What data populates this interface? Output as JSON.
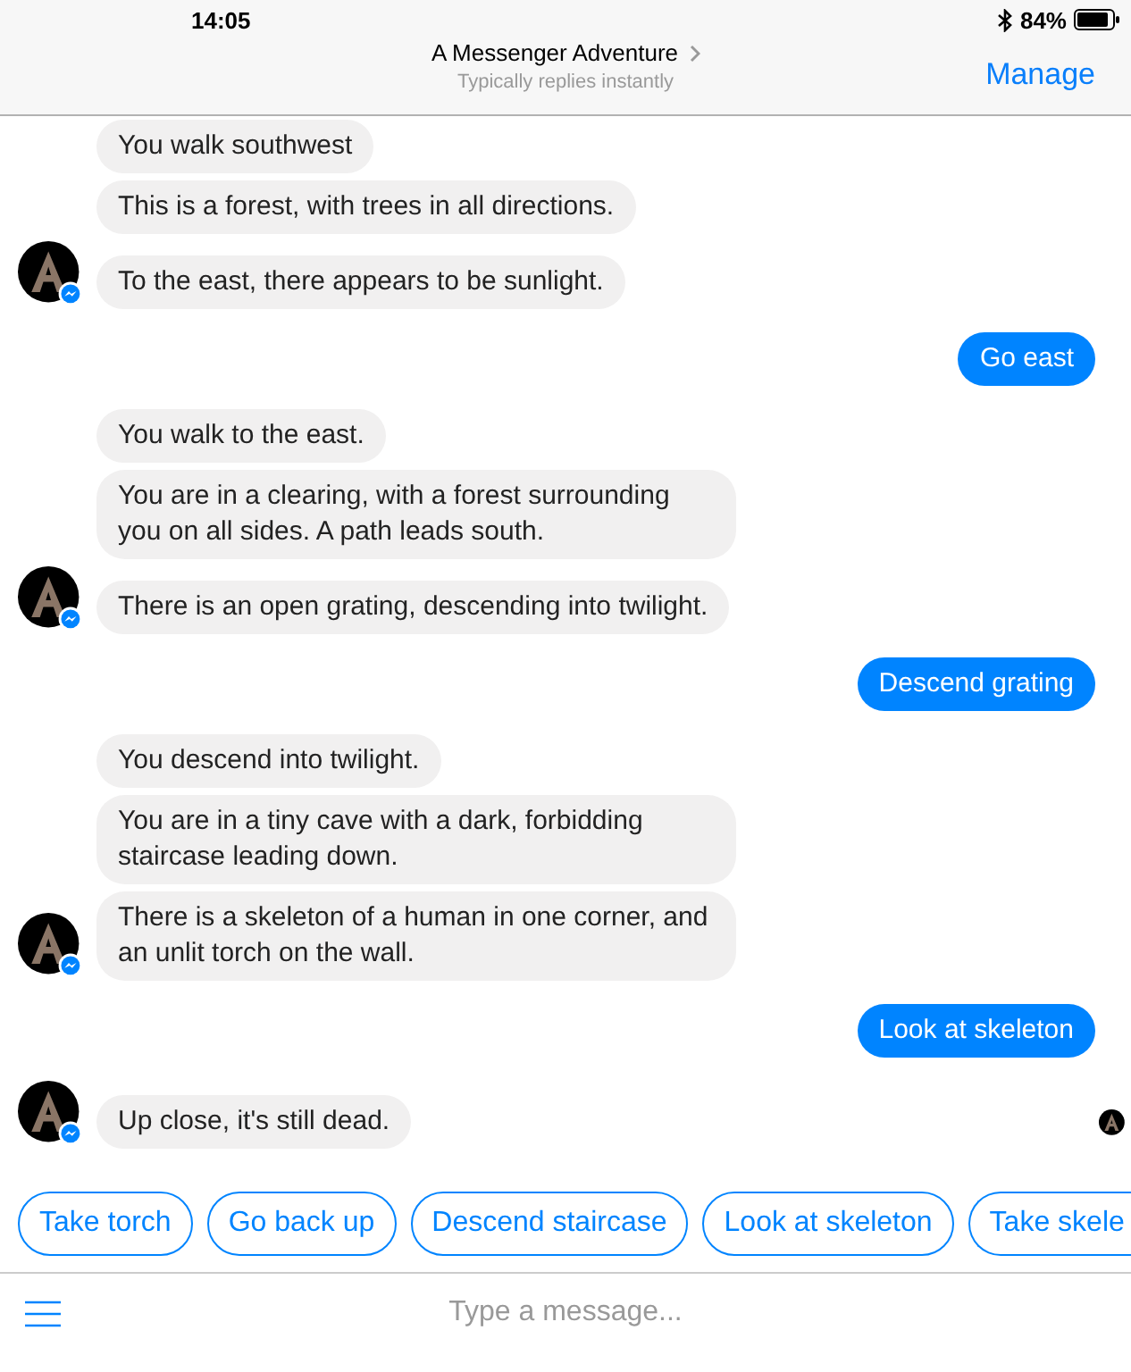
{
  "status_bar": {
    "time": "14:05",
    "battery": "84%"
  },
  "header": {
    "title": "A Messenger Adventure",
    "subtitle": "Typically replies instantly",
    "action": "Manage"
  },
  "messages": [
    {
      "kind": "bot",
      "bubbles": [
        "You walk southwest",
        "This is a forest, with trees in all directions.",
        "To the east, there appears to be sunlight."
      ]
    },
    {
      "kind": "user",
      "bubbles": [
        "Go east"
      ]
    },
    {
      "kind": "bot",
      "bubbles": [
        "You walk to the east.",
        "You are in a clearing, with a forest surrounding you on all sides. A path leads south.",
        "There is an open grating, descending into twilight."
      ]
    },
    {
      "kind": "user",
      "bubbles": [
        "Descend grating"
      ]
    },
    {
      "kind": "bot",
      "bubbles": [
        "You descend into twilight.",
        "You are in a tiny cave with a dark, forbidding staircase leading down.",
        "There is a skeleton of a human in one corner, and an unlit torch on the wall."
      ]
    },
    {
      "kind": "user",
      "bubbles": [
        "Look at skeleton"
      ]
    },
    {
      "kind": "bot",
      "bubbles": [
        "Up close, it's still dead."
      ]
    }
  ],
  "quick_replies": [
    "Take torch",
    "Go back up",
    "Descend staircase",
    "Look at skeleton",
    "Take skele"
  ],
  "composer": {
    "placeholder": "Type a message..."
  }
}
